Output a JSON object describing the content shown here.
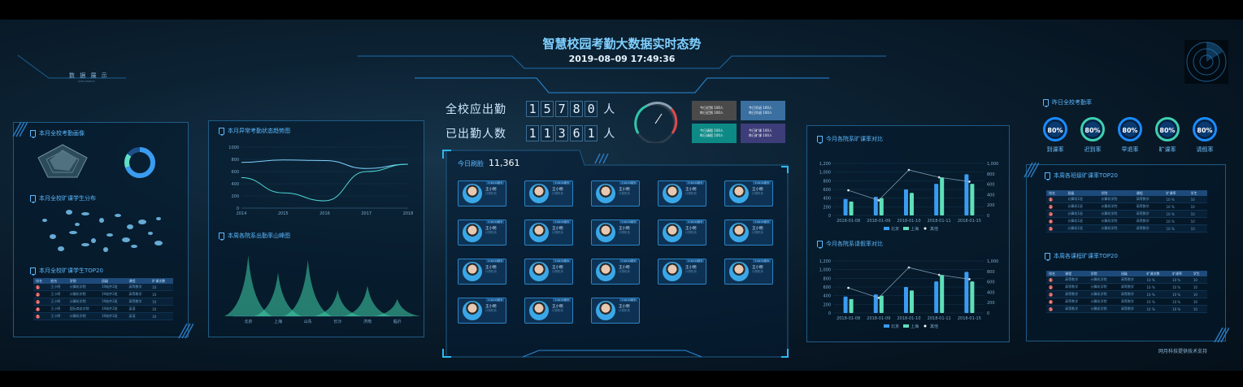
{
  "header": {
    "title": "智慧校园考勤大数据实时态势",
    "datetime": "2019–08–09 17:49:36"
  },
  "left_top": {
    "title": "数 据 展 示",
    "subtitle": "DATA DISPLAY"
  },
  "panels": {
    "attendance_portrait": "本月全校考勤画像",
    "absent_distribution": "本月全校旷课学生分布",
    "absent_top10": "本月全校旷课学生TOP20",
    "abnormal_trend": "本月异常考勤状态趋势图",
    "dept_absent_mountain": "本周各院系出勤率山峰图",
    "today_checkin": "今日刷脸",
    "monthly_dept_compare": "今月各院系旷课率对比",
    "monthly_leave_compare": "今月各院系请假率对比",
    "school_stats": "昨日全校考勤率",
    "dept_top20": "本周各班级旷课率TOP20",
    "class_top20": "本周各课程旷课率TOP20"
  },
  "stats": {
    "expected_label": "全校应出勤",
    "expected_digits": [
      "1",
      "5",
      "7",
      "8",
      "0"
    ],
    "unit": "人",
    "actual_label": "已出勤人数",
    "actual_digits": [
      "1",
      "1",
      "3",
      "6",
      "1"
    ],
    "today_count": "11,361"
  },
  "status_boxes": [
    {
      "line1": "今日迟到 100人",
      "line2": "昨日迟到 100人",
      "color": "#4a4a4a"
    },
    {
      "line1": "今日早退 100人",
      "line2": "昨日早退 100人",
      "color": "#3a6fa0"
    },
    {
      "line1": "今日请假 100人",
      "line2": "昨日请假 100人",
      "color": "#0e8a86"
    },
    {
      "line1": "今日旷课 100人",
      "line2": "昨日旷课 100人",
      "color": "#3d3d7a"
    }
  ],
  "cards": [
    {
      "name": "王小明",
      "tag": "7:49:32刷卡"
    },
    {
      "name": "王小明",
      "tag": "7:49:32刷卡"
    },
    {
      "name": "王小明",
      "tag": "7:49:32刷卡"
    },
    {
      "name": "王小明",
      "tag": "7:49:32刷卡"
    },
    {
      "name": "王小明",
      "tag": "7:49:32刷卡"
    },
    {
      "name": "王小明",
      "tag": "7:49:32刷卡"
    },
    {
      "name": "王小明",
      "tag": "7:49:32刷卡"
    },
    {
      "name": "王小明",
      "tag": "7:49:32刷卡"
    },
    {
      "name": "王小明",
      "tag": "7:49:32刷卡"
    },
    {
      "name": "王小明",
      "tag": "7:49:32刷卡"
    },
    {
      "name": "王小明",
      "tag": "7:49:32刷卡"
    },
    {
      "name": "王小明",
      "tag": "7:49:32刷卡"
    },
    {
      "name": "王小明",
      "tag": "7:49:32刷卡"
    },
    {
      "name": "王小明",
      "tag": "7:49:32刷卡"
    },
    {
      "name": "王小明",
      "tag": "7:49:32刷卡"
    },
    {
      "name": "王小明",
      "tag": "7:49:32刷卡"
    },
    {
      "name": "王小明",
      "tag": "7:49:32刷卡"
    },
    {
      "name": "王小明",
      "tag": "7:49:32刷卡"
    }
  ],
  "card_sub": "计算机系",
  "rings": [
    {
      "value": "80%",
      "label": "到课率",
      "color": "#1a8cff"
    },
    {
      "value": "80%",
      "label": "迟到率",
      "color": "#3fd0b0"
    },
    {
      "value": "80%",
      "label": "早退率",
      "color": "#1a8cff"
    },
    {
      "value": "80%",
      "label": "旷课率",
      "color": "#3fd0b0"
    },
    {
      "value": "80%",
      "label": "请假率",
      "color": "#1a8cff"
    }
  ],
  "left_table": {
    "headers": [
      "排名",
      "姓名",
      "学院",
      "班级",
      "课程",
      "旷课次数"
    ],
    "rows": [
      [
        "1",
        "王小明",
        "计算机学院",
        "19软件2班",
        "高等数学",
        "10"
      ],
      [
        "2",
        "王小明",
        "计算机学院",
        "19软件2班",
        "高等数学",
        "10"
      ],
      [
        "3",
        "王小明",
        "计算机学院",
        "19软件2班",
        "高等数学",
        "10"
      ],
      [
        "4",
        "王小明",
        "国际商务学院",
        "19软件2班",
        "英语",
        "10"
      ],
      [
        "5",
        "王小明",
        "计算机学院",
        "19软件2班",
        "英语",
        "10"
      ]
    ]
  },
  "right_table1": {
    "headers": [
      "排名",
      "班级",
      "学院",
      "课程",
      "旷课率",
      "学生"
    ],
    "rows": [
      [
        "1",
        "计算机1班",
        "计算机学院",
        "高等数学",
        "10 %",
        "10"
      ],
      [
        "2",
        "计算机1班",
        "计算机学院",
        "高等数学",
        "10 %",
        "10"
      ],
      [
        "3",
        "计算机1班",
        "计算机学院",
        "高等数学",
        "10 %",
        "10"
      ],
      [
        "4",
        "计算机1班",
        "计算机学院",
        "高等数学",
        "10 %",
        "10"
      ],
      [
        "5",
        "计算机1班",
        "计算机学院",
        "高等数学",
        "10 %",
        "10"
      ]
    ]
  },
  "right_table2": {
    "headers": [
      "排名",
      "课程",
      "学院",
      "班级",
      "旷课次数",
      "旷课率",
      "学生"
    ],
    "rows": [
      [
        "1",
        "高等数学",
        "计算机学院",
        "高等数学",
        "10 %",
        "10 %",
        "10"
      ],
      [
        "2",
        "高等数学",
        "计算机学院",
        "高等数学",
        "10 %",
        "10 %",
        "10"
      ],
      [
        "3",
        "高等数学",
        "计算机学院",
        "高等数学",
        "10 %",
        "10 %",
        "10"
      ],
      [
        "4",
        "高等数学",
        "计算机学院",
        "高等数学",
        "10 %",
        "10 %",
        "10"
      ],
      [
        "5",
        "高等数学",
        "计算机学院",
        "高等数学",
        "10 %",
        "10 %",
        "10"
      ]
    ]
  },
  "footer": "网月科技提供技术支持",
  "chart_data": [
    {
      "type": "line",
      "x": [
        "2014",
        "2015",
        "2016",
        "2017",
        "2018"
      ],
      "yticks": [
        "0",
        "200",
        "400",
        "600",
        "800",
        "1000"
      ],
      "series": [
        {
          "values": [
            750,
            790,
            780,
            650,
            720
          ]
        },
        {
          "values": [
            500,
            250,
            120,
            600,
            720
          ]
        }
      ],
      "ylim": [
        0,
        1000
      ]
    },
    {
      "type": "area",
      "categories": [
        "北京",
        "上海",
        "山东",
        "长沙",
        "济南",
        "临沂"
      ],
      "values": [
        70,
        50,
        65,
        30,
        35,
        20
      ]
    },
    {
      "type": "bar",
      "categories": [
        "2018-01-08",
        "2018-01-09",
        "2018-01-10",
        "2018-01-11",
        "2018-01-15"
      ],
      "series": [
        {
          "name": "北京",
          "values": [
            380,
            430,
            600,
            730,
            950
          ]
        },
        {
          "name": "上海",
          "values": [
            320,
            400,
            520,
            880,
            730
          ]
        },
        {
          "name": "其他",
          "values": [
            580,
            350,
            1050,
            880,
            780
          ]
        }
      ],
      "yticks": [
        "0",
        "200",
        "400",
        "600",
        "800",
        "1,000",
        "1,200"
      ],
      "y2ticks": [
        "0",
        "200",
        "400",
        "600",
        "800",
        "1,000"
      ],
      "ylim": [
        0,
        1200
      ]
    },
    {
      "type": "bar",
      "categories": [
        "2018-01-08",
        "2018-01-09",
        "2018-01-10",
        "2018-01-11",
        "2018-01-15"
      ],
      "series": [
        {
          "name": "北京",
          "values": [
            380,
            430,
            600,
            730,
            950
          ]
        },
        {
          "name": "上海",
          "values": [
            320,
            400,
            520,
            880,
            730
          ]
        },
        {
          "name": "其他",
          "values": [
            580,
            350,
            1050,
            880,
            780
          ]
        }
      ],
      "yticks": [
        "0",
        "200",
        "400",
        "600",
        "800",
        "1,000",
        "1,200"
      ],
      "y2ticks": [
        "0",
        "200",
        "400",
        "600",
        "800",
        "1,000"
      ],
      "ylim": [
        0,
        1200
      ]
    }
  ]
}
